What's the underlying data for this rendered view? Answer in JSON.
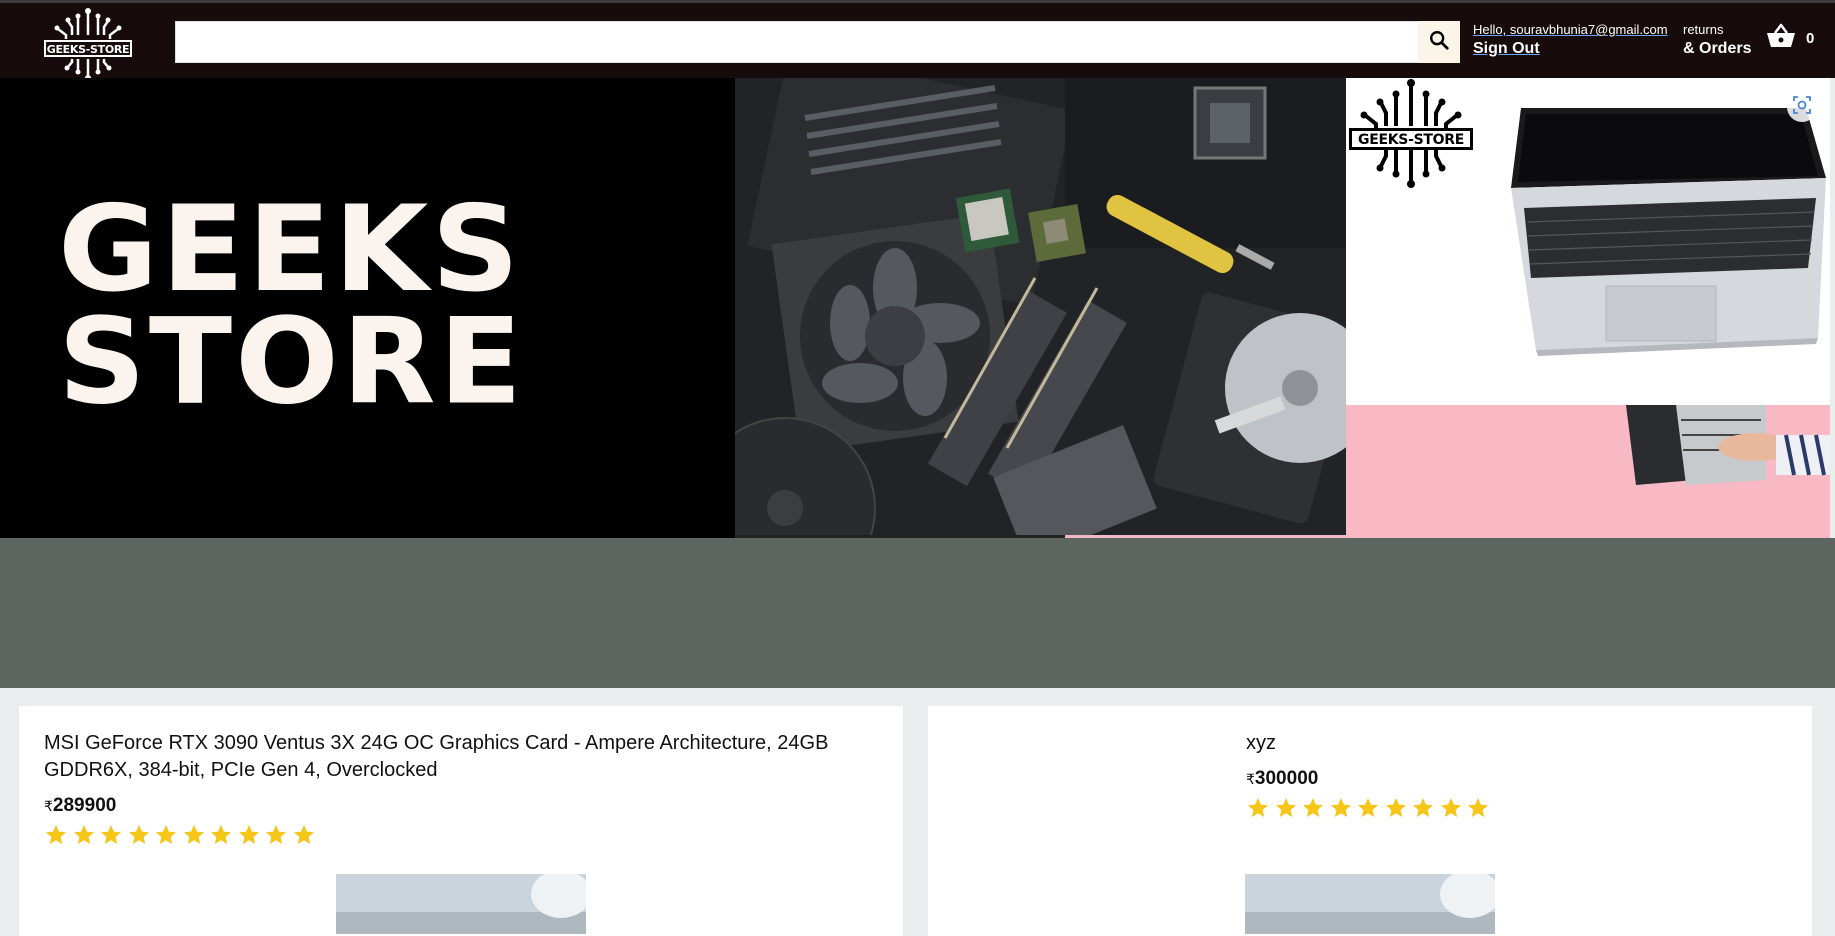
{
  "header": {
    "logo_text": "GEEKS-STORE",
    "search_placeholder": "",
    "account_line1": "Hello, souravbhunia7@gmail.com",
    "account_line2": "Sign Out",
    "orders_line1": "returns",
    "orders_line2": "& Orders",
    "basket_count": "0"
  },
  "hero": {
    "title_line1": "GEEKS",
    "title_line2": "STORE",
    "logo_text": "GEEKS-STORE"
  },
  "products": [
    {
      "title": "MSI GeForce RTX 3090 Ventus 3X 24G OC Graphics Card - Ampere Architecture, 24GB GDDR6X, 384-bit, PCIe Gen 4, Overclocked",
      "currency": "₹",
      "price": "289900",
      "rating": 10
    },
    {
      "title": "xyz",
      "currency": "₹",
      "price": "300000",
      "rating": 9
    }
  ],
  "colors": {
    "header_bg": "#180b0b",
    "star": "#f5c518",
    "page_bg": "#eaeded"
  }
}
